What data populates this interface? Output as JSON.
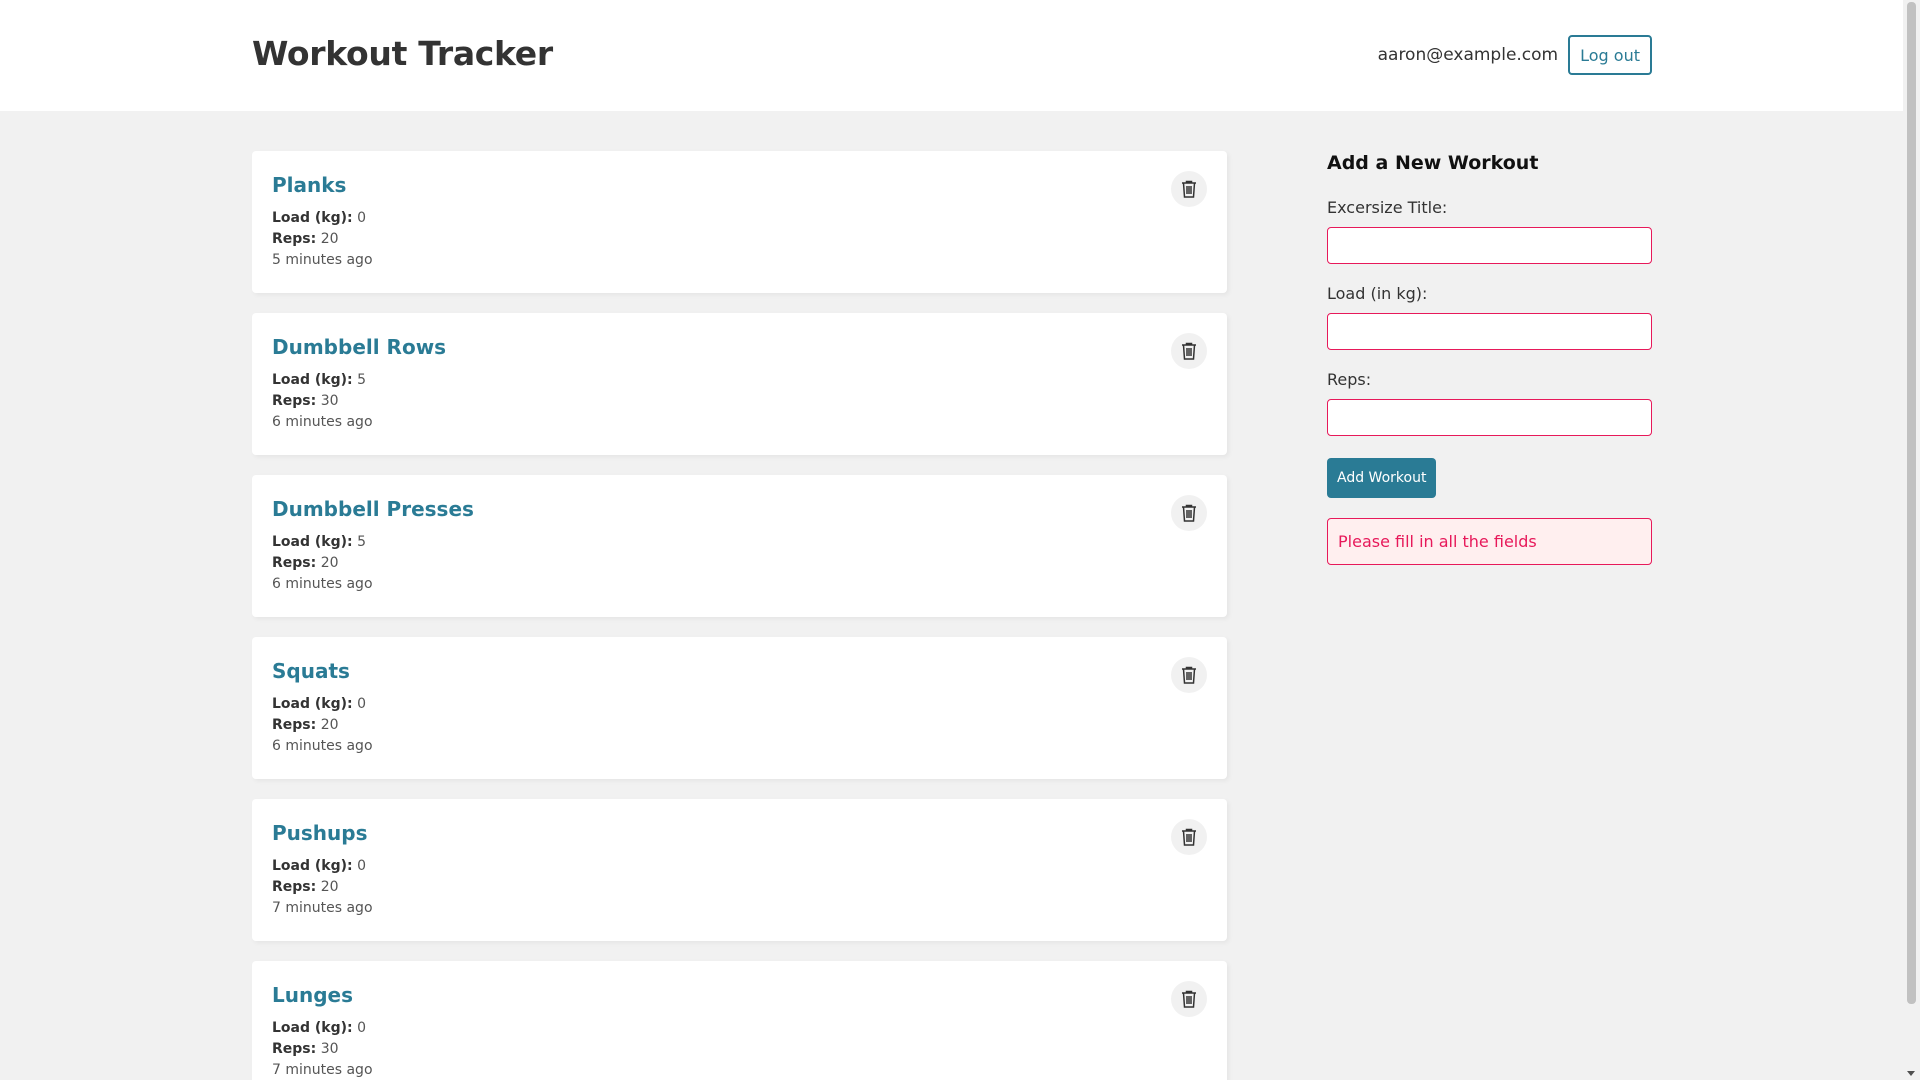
{
  "header": {
    "title": "Workout Tracker",
    "user_email": "aaron@example.com",
    "logout_label": "Log out"
  },
  "workouts": [
    {
      "title": "Planks",
      "load_label": "Load (kg):",
      "load": "0",
      "reps_label": "Reps:",
      "reps": "20",
      "time": "5 minutes ago"
    },
    {
      "title": "Dumbbell Rows",
      "load_label": "Load (kg):",
      "load": "5",
      "reps_label": "Reps:",
      "reps": "30",
      "time": "6 minutes ago"
    },
    {
      "title": "Dumbbell Presses",
      "load_label": "Load (kg):",
      "load": "5",
      "reps_label": "Reps:",
      "reps": "20",
      "time": "6 minutes ago"
    },
    {
      "title": "Squats",
      "load_label": "Load (kg):",
      "load": "0",
      "reps_label": "Reps:",
      "reps": "20",
      "time": "6 minutes ago"
    },
    {
      "title": "Pushups",
      "load_label": "Load (kg):",
      "load": "0",
      "reps_label": "Reps:",
      "reps": "20",
      "time": "7 minutes ago"
    },
    {
      "title": "Lunges",
      "load_label": "Load (kg):",
      "load": "0",
      "reps_label": "Reps:",
      "reps": "30",
      "time": "7 minutes ago"
    }
  ],
  "form": {
    "title": "Add a New Workout",
    "title_label": "Excersize Title:",
    "title_value": "",
    "load_label": "Load (in kg):",
    "load_value": "",
    "reps_label": "Reps:",
    "reps_value": "",
    "submit_label": "Add Workout",
    "error": "Please fill in all the fields"
  },
  "icons": {
    "delete": "trash-icon"
  },
  "colors": {
    "accent": "#2a7b95",
    "error": "#e7195a",
    "error_bg": "#ffefef",
    "background": "#f1f1f1"
  }
}
